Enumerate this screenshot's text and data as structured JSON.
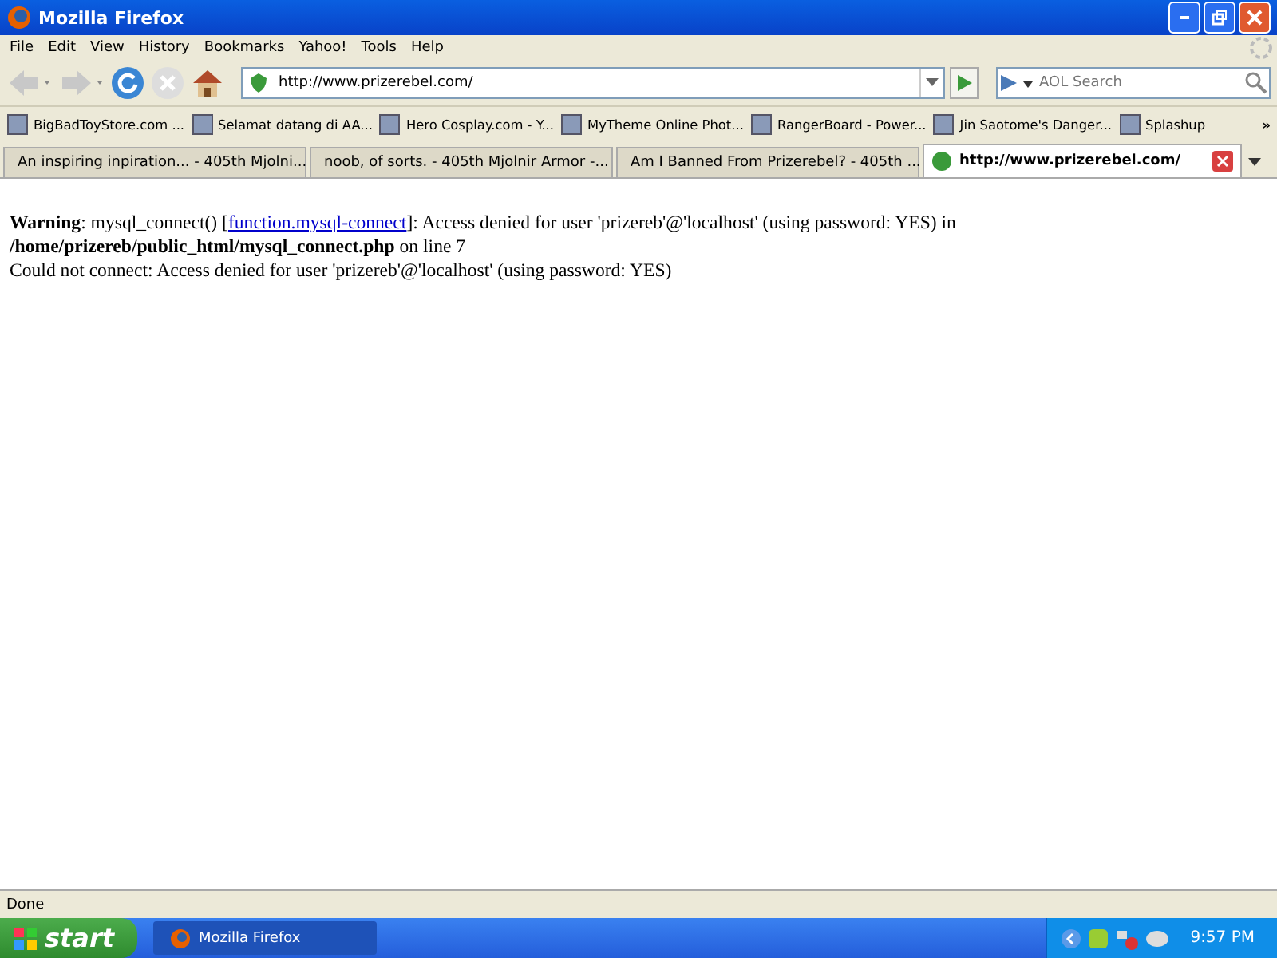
{
  "window": {
    "title": "Mozilla Firefox"
  },
  "menu": [
    "File",
    "Edit",
    "View",
    "History",
    "Bookmarks",
    "Yahoo!",
    "Tools",
    "Help"
  ],
  "address": {
    "value": "http://www.prizerebel.com/"
  },
  "search": {
    "placeholder": "AOL Search"
  },
  "bookmarks": [
    "BigBadToyStore.com ...",
    "Selamat datang di AA...",
    "Hero Cosplay.com - Y...",
    "MyTheme Online Phot...",
    "RangerBoard - Power...",
    "Jin Saotome's Danger...",
    "Splashup"
  ],
  "bookmarks_more": "»",
  "tabs": [
    {
      "label": "An inspiring inpiration... - 405th Mjolni...",
      "selected": false
    },
    {
      "label": "noob, of sorts. - 405th Mjolnir Armor -...",
      "selected": false
    },
    {
      "label": "Am I Banned From Prizerebel? - 405th ...",
      "selected": false
    },
    {
      "label": "http://www.prizerebel.com/",
      "selected": true
    }
  ],
  "page": {
    "warning_before": "**Warning**: mysql_connect() [",
    "warning_link": "function.mysql-connect",
    "warning_after": "]: Access denied for user 'prizereb'@'localhost' (using password: YES) in **/home/prizereb/public_html/mysql_connect.php** on line 7",
    "error": "Could not connect: Access denied for user 'prizereb'@'localhost' (using password: YES)"
  },
  "status_bar": "Done",
  "taskbar": {
    "start": "start",
    "task": "Mozilla Firefox",
    "clock": "9:57 PM"
  }
}
